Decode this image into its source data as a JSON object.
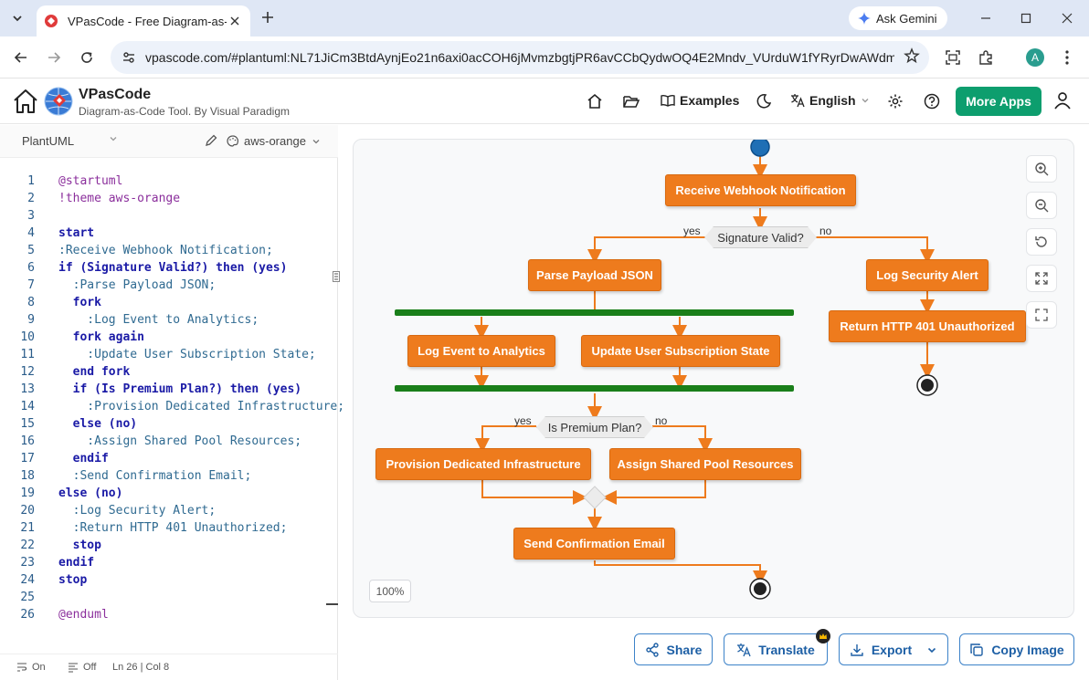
{
  "browser": {
    "tab_title": "VPasCode - Free Diagram-as-Co",
    "url": "vpascode.com/#plantuml:NL71JiCm3BtdAynjEo21n6axi0acCOH6jMvmzbgtjPR6avCCbQydwOQ4E2Mndv_VUrduW1fYRyrDwAWdm...",
    "gemini_label": "Ask Gemini",
    "profile_initial": "A"
  },
  "app": {
    "brand": "VPasCode",
    "tagline": "Diagram-as-Code Tool. By Visual Paradigm",
    "nav": {
      "examples": "Examples",
      "language": "English",
      "more_apps": "More Apps"
    }
  },
  "editor": {
    "language": "PlantUML",
    "theme": "aws-orange",
    "status": {
      "wrap": "On",
      "minimap": "Off",
      "position": "Ln 26 | Col 8"
    },
    "lines": [
      {
        "n": "1",
        "t": "@startuml"
      },
      {
        "n": "2",
        "t": "!theme aws-orange"
      },
      {
        "n": "3",
        "t": ""
      },
      {
        "n": "4",
        "t": "start"
      },
      {
        "n": "5",
        "t": ":Receive Webhook Notification;"
      },
      {
        "n": "6",
        "t": "if (Signature Valid?) then (yes)"
      },
      {
        "n": "7",
        "t": "  :Parse Payload JSON;"
      },
      {
        "n": "8",
        "t": "  fork"
      },
      {
        "n": "9",
        "t": "    :Log Event to Analytics;"
      },
      {
        "n": "10",
        "t": "  fork again"
      },
      {
        "n": "11",
        "t": "    :Update User Subscription State;"
      },
      {
        "n": "12",
        "t": "  end fork"
      },
      {
        "n": "13",
        "t": "  if (Is Premium Plan?) then (yes)"
      },
      {
        "n": "14",
        "t": "    :Provision Dedicated Infrastructure;"
      },
      {
        "n": "15",
        "t": "  else (no)"
      },
      {
        "n": "16",
        "t": "    :Assign Shared Pool Resources;"
      },
      {
        "n": "17",
        "t": "  endif"
      },
      {
        "n": "18",
        "t": "  :Send Confirmation Email;"
      },
      {
        "n": "19",
        "t": "else (no)"
      },
      {
        "n": "20",
        "t": "  :Log Security Alert;"
      },
      {
        "n": "21",
        "t": "  :Return HTTP 401 Unauthorized;"
      },
      {
        "n": "22",
        "t": "  stop"
      },
      {
        "n": "23",
        "t": "endif"
      },
      {
        "n": "24",
        "t": "stop"
      },
      {
        "n": "25",
        "t": ""
      },
      {
        "n": "26",
        "t": "@enduml"
      }
    ]
  },
  "diagram": {
    "zoom": "100%",
    "activities": {
      "receive": "Receive Webhook Notification",
      "parse": "Parse Payload JSON",
      "log_alert": "Log Security Alert",
      "return401": "Return HTTP 401 Unauthorized",
      "log_event": "Log Event to Analytics",
      "update_sub": "Update User Subscription State",
      "provision": "Provision Dedicated Infrastructure",
      "assign": "Assign Shared Pool Resources",
      "send_email": "Send Confirmation Email"
    },
    "decisions": {
      "signature": "Signature Valid?",
      "premium": "Is Premium Plan?"
    },
    "labels": {
      "yes1": "yes",
      "no1": "no",
      "yes2": "yes",
      "no2": "no"
    },
    "colors": {
      "activity": "#ee7b1d",
      "arrow": "#ee7b1d",
      "fork_bar": "#1a7f1a",
      "start": "#1f6fb5"
    }
  },
  "actions": {
    "share": "Share",
    "translate": "Translate",
    "export": "Export",
    "copy_image": "Copy Image"
  }
}
